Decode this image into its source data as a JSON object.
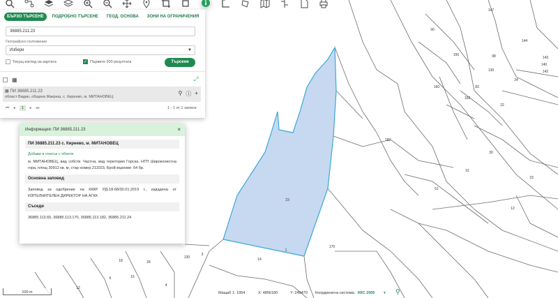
{
  "toolbar": {
    "tools": [
      {
        "name": "search-icon"
      },
      {
        "name": "route-icon"
      },
      {
        "name": "layers-icon"
      },
      {
        "name": "layers-alt-icon"
      },
      {
        "name": "zoom-in-icon"
      },
      {
        "name": "zoom-out-icon"
      },
      {
        "name": "pan-icon"
      },
      {
        "name": "location-pin-icon"
      },
      {
        "name": "crop-icon"
      },
      {
        "name": "info-icon"
      },
      {
        "name": "measure-icon"
      },
      {
        "name": "measure-area-icon"
      },
      {
        "name": "map-icon"
      },
      {
        "name": "split-icon"
      },
      {
        "name": "document-icon"
      },
      {
        "name": "print-icon"
      }
    ]
  },
  "search_panel": {
    "tabs": [
      "БЪРЗО ТЪРСЕНЕ",
      "ПОДРОБНО ТЪРСЕНЕ",
      "ГЕОД. ОСНОВА",
      "ЗОНИ НА ОГРАНИЧЕНИЯ"
    ],
    "search_value": "36885.211.23",
    "geo_label": "Географско положение",
    "geo_value": "Избери",
    "current_view_label": "Текущ изглед на картата",
    "first200_label": "Първите 200 резултата",
    "search_button": "Търсене",
    "result_title": "ПИ 36885.211.23",
    "result_subtitle": "област Видин, община Макреш, с. Киреево, м. МИТАНОВЕЦ",
    "pager_page": "1",
    "pager_info": "1 - 1 от 1 записи"
  },
  "info_window": {
    "header": "Информация: ПИ 36885.211.23",
    "title": "ПИ 36885.211.23 с. Киреево, м. МИТАНОВЕЦ",
    "add_link": "Добави в списък с обекти",
    "description": "м. МИТАНОВЕЦ, вид собств. Частна, вид територия Горска, НТП Широколистна гора, площ 30912 кв. м, стар номер 211023, Брой върхове: 64 бр.",
    "order_title": "Основна заповед",
    "order_text": "Заповед за одобрение на КККР РД-18-68/30.01.2019 г., издадена от ИЗПЪЛНИТЕЛЕН ДИРЕКТОР НА АГКК",
    "neighbors_title": "Съседи",
    "neighbors": "36885.113.65, 36885.113.170, 36885.113.182, 36885.211.24"
  },
  "status": {
    "scale_bar": "100 m",
    "scale": "Мащаб 1: 1954",
    "x": "X: 4856180",
    "y": "Y: 249470",
    "crs_label": "Координатна система:",
    "crs_value": "ККС 2005"
  },
  "map": {
    "highlight_fill": "#c6d9f0",
    "highlight_stroke": "#3aa7d8",
    "parcel_labels": [
      "147",
      "90",
      "144",
      "143",
      "140",
      "150",
      "98",
      "130",
      "142",
      "24",
      "83",
      "160",
      "152",
      "22",
      "182",
      "30",
      "31",
      "23",
      "51",
      "23",
      "170",
      "14",
      "24",
      "15",
      "6",
      "18",
      "130",
      "12",
      "4",
      "3",
      "1",
      "12"
    ]
  },
  "colors": {
    "accent": "#1f8a50"
  }
}
